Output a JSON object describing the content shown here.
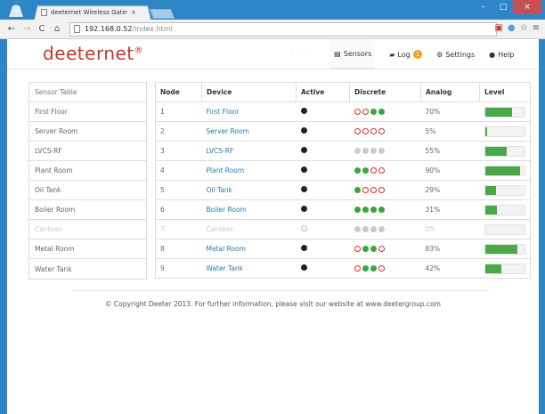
{
  "browser": {
    "tab_title": "deeternet Wireless Gatew",
    "tab_close": "×",
    "url_host": "192.168.0.52",
    "url_path": "/index.html",
    "window_buttons": [
      "–",
      "□",
      "×"
    ]
  },
  "brand": {
    "name": "deeternet",
    "mark": "®"
  },
  "nav": {
    "sensors": "Sensors",
    "log": "Log",
    "log_count": "1",
    "settings": "Settings",
    "help": "Help"
  },
  "sidebar": {
    "header": "Sensor Table",
    "items": [
      "First Floor",
      "Server Room",
      "LVCS-RF",
      "Plant Room",
      "Oil Tank",
      "Boiler Room",
      "Canteen",
      "Metal Room",
      "Water Tank"
    ]
  },
  "table": {
    "headers": [
      "Node",
      "Device",
      "Active",
      "Discrete",
      "Analog",
      "Level"
    ],
    "rows": [
      {
        "node": "1",
        "device": "First Floor",
        "active": true,
        "discrete": [
          "red",
          "red",
          "green",
          "green"
        ],
        "analog": "70%",
        "level": 0.7
      },
      {
        "node": "2",
        "device": "Server Room",
        "active": true,
        "discrete": [
          "red",
          "red",
          "red",
          "red"
        ],
        "analog": "5%",
        "level": 0.05
      },
      {
        "node": "3",
        "device": "LVCS-RF",
        "active": true,
        "discrete": [
          "grey",
          "grey",
          "grey",
          "grey"
        ],
        "analog": "55%",
        "level": 0.55
      },
      {
        "node": "4",
        "device": "Plant Room",
        "active": true,
        "discrete": [
          "green",
          "green",
          "red",
          "red"
        ],
        "analog": "90%",
        "level": 0.9
      },
      {
        "node": "5",
        "device": "Oil Tank",
        "active": true,
        "discrete": [
          "green",
          "red",
          "red",
          "red"
        ],
        "analog": "29%",
        "level": 0.29
      },
      {
        "node": "6",
        "device": "Boiler Room",
        "active": true,
        "discrete": [
          "green",
          "green",
          "green",
          "green"
        ],
        "analog": "31%",
        "level": 0.31
      },
      {
        "node": "7",
        "device": "Canteen",
        "active": false,
        "discrete": [
          "grey",
          "grey",
          "grey",
          "grey"
        ],
        "analog": "0%",
        "level": 0.0
      },
      {
        "node": "8",
        "device": "Metal Room",
        "active": true,
        "discrete": [
          "red",
          "green",
          "green",
          "red"
        ],
        "analog": "83%",
        "level": 0.83
      },
      {
        "node": "9",
        "device": "Water Tank",
        "active": true,
        "discrete": [
          "red",
          "green",
          "green",
          "red"
        ],
        "analog": "42%",
        "level": 0.42
      }
    ]
  },
  "footer": "© Copyright Deeter 2013. For further information, please visit our website at www.deetergroup.com",
  "colors": {
    "brand": "#c0392b",
    "link": "#2a7ab0",
    "green": "#4aa84a",
    "red": "#d03030",
    "badge": "#f0a020"
  }
}
